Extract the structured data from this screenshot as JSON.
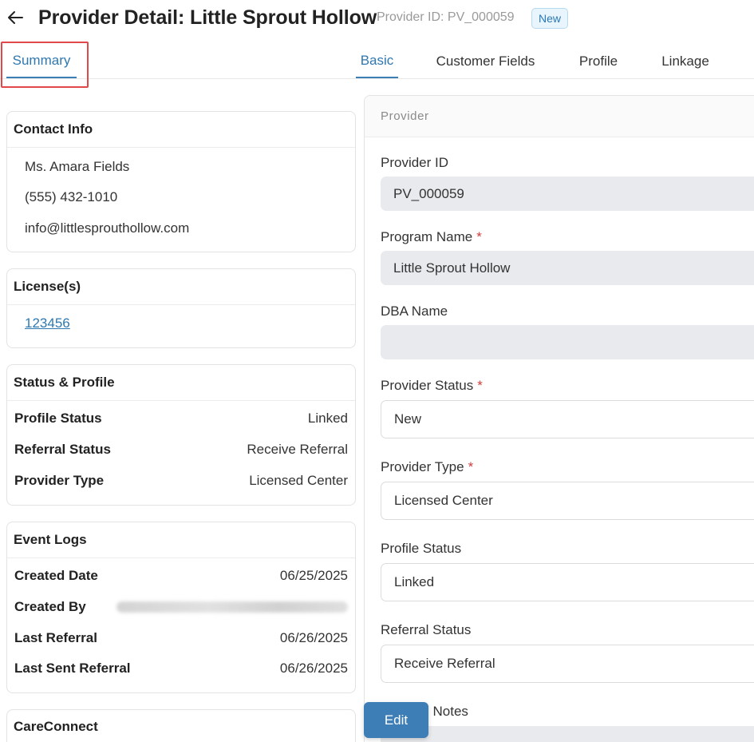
{
  "header": {
    "title": "Provider Detail: Little Sprout Hollow",
    "provider_id": "Provider ID: PV_000059",
    "status_badge": "New"
  },
  "tabs": {
    "summary": "Summary",
    "items": [
      {
        "label": "Basic"
      },
      {
        "label": "Customer Fields"
      },
      {
        "label": "Profile"
      },
      {
        "label": "Linkage"
      }
    ]
  },
  "contact_info": {
    "title": "Contact Info",
    "name": "Ms. Amara Fields",
    "phone": "(555) 432-1010",
    "email": "info@littlesprouthollow.com"
  },
  "licenses": {
    "title": "License(s)",
    "link": "123456"
  },
  "status_profile": {
    "title": "Status & Profile",
    "rows": [
      {
        "label": "Profile Status",
        "value": "Linked"
      },
      {
        "label": "Referral Status",
        "value": "Receive Referral"
      },
      {
        "label": "Provider Type",
        "value": "Licensed Center"
      }
    ]
  },
  "event_logs": {
    "title": "Event Logs",
    "created_date_label": "Created Date",
    "created_date": "06/25/2025",
    "created_by_label": "Created By",
    "last_referral_label": "Last Referral",
    "last_referral": "06/26/2025",
    "last_sent_label": "Last Sent Referral",
    "last_sent": "06/26/2025"
  },
  "careconnect": {
    "title": "CareConnect"
  },
  "provider_form": {
    "section": "Provider",
    "provider_id_label": "Provider ID",
    "provider_id_value": "PV_000059",
    "program_name_label": "Program Name",
    "program_name_value": "Little Sprout Hollow",
    "dba_label": "DBA Name",
    "dba_value": "",
    "status_label": "Provider Status",
    "status_value": "New",
    "type_label": "Provider Type",
    "type_value": "Licensed Center",
    "profile_status_label": "Profile Status",
    "profile_status_value": "Linked",
    "referral_status_label": "Referral Status",
    "referral_status_value": "Receive Referral",
    "notes_label": "l Notes",
    "required_mark": "*"
  },
  "actions": {
    "edit": "Edit"
  },
  "colors": {
    "accent": "#3d7eb6",
    "highlight": "#e0484a",
    "required": "#d23b3b"
  }
}
